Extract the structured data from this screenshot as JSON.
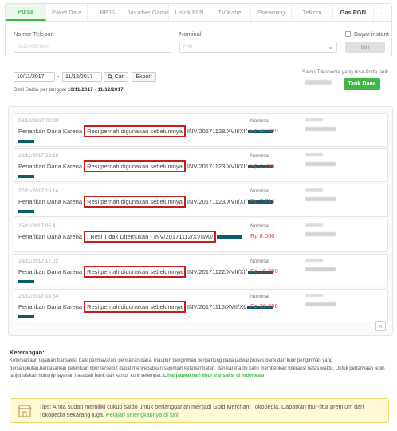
{
  "tabs": [
    {
      "label": "Pulsa",
      "active": true
    },
    {
      "label": "Paket Data"
    },
    {
      "label": "BPJS"
    },
    {
      "label": "Voucher Game"
    },
    {
      "label": "Listrik PLN"
    },
    {
      "label": "TV Kabel"
    },
    {
      "label": "Streaming"
    },
    {
      "label": "Telkom"
    },
    {
      "label": "Gas PGN"
    }
  ],
  "more_icon": "chevron-down-icon",
  "form": {
    "phone_label": "Nomor Telepon",
    "phone_placeholder": "081234567890",
    "nominal_label": "Nominal",
    "nominal_placeholder": "Pilih",
    "instant_label": "Bayar instant",
    "buy_label": "Beli"
  },
  "filter": {
    "start_date": "10/11/2017",
    "separator": "-",
    "end_date": "11/12/2017",
    "search_label": "Cari",
    "export_label": "Export",
    "detail_prefix": "Detil Saldo per tanggal",
    "detail_range": "10/11/2017 - 11/12/2017"
  },
  "saldo": {
    "label": "Saldo Tokopedia yang bisa Anda tarik",
    "withdraw_label": "Tarik Dana"
  },
  "transactions": [
    {
      "date": "08/12/2017 00:28",
      "prefix": "Penarikan Dana Karena",
      "reason": "Resi pernah digunakan sebelumnya",
      "invoice": "INV/20171128/XVII/XI/",
      "nominal_label": "Nominal",
      "amount": "Rp 40.000"
    },
    {
      "date": "28/11/2017 22:18",
      "prefix": "Penarikan Dana Karena",
      "reason": "Resi pernah digunakan sebelumnya",
      "invoice": "INV/20171123/XVII/XI/",
      "nominal_label": "Nominal",
      "amount": "Rp 2.286"
    },
    {
      "date": "27/11/2017 15:14",
      "prefix": "Penarikan Dana Karena",
      "reason": "Resi pernah digunakan sebelumnya",
      "invoice": "INV/20171123/XVII/XI/",
      "nominal_label": "Nominal",
      "amount": "Rp 7.714"
    },
    {
      "date": "25/11/2017 05:41",
      "prefix": "Penarikan Dana Karena",
      "reason": ": Resi Tidak Ditemukan - INV/20171112/XVII/XI/",
      "invoice": "",
      "nominal_label": "Nominal",
      "amount": "Rp 8.000"
    },
    {
      "date": "24/11/2017 17:02",
      "prefix": "Penarikan Dana Karena",
      "reason": "Resi pernah digunakan sebelumnya",
      "invoice": "INV/20171122/XVII/XI/",
      "nominal_label": "Nominal",
      "amount": "Rp 19.000"
    },
    {
      "date": "23/11/2017 09:54",
      "prefix": "Penarikan Dana Karena",
      "reason": "Resi pernah digunakan sebelumnya",
      "invoice": "INV/20171115/XVII/XI/",
      "nominal_label": "Nominal",
      "amount": "Rp 39.000"
    }
  ],
  "pager_label": "«",
  "keterangan": {
    "title": "Keterangan:",
    "body": "Ketersediaan layanan transaksi, baik pembayaran, pencairan dana, maupun pengiriman bergantung pada jadwal proses bank dan kurir pengiriman yang bersangkutan,berdasarkan ketentuan libur tersebut dapat menyebabkan sejumlah keterlambatan, dan karena itu kami memberikan toleransi batas waktu. Untuk pertanyaan lebih lanjut,silakan hubungi layanan nasabah bank dan kantor kurir setempat.",
    "link": "Lihat jadwal hari libur transaksi di Indonesia"
  },
  "tips": {
    "text": "Tips: Anda sudah memiliki cukup saldo untuk berlangganan menjadi Gold Merchant Tokopedia. Dapatkan fitur-fitur premium dari Tokopedia sekarang juga.",
    "link": "Pelajari selengkapnya di sini.",
    "icon": "store-icon"
  },
  "colors": {
    "accent": "#42b549",
    "amount": "#e0403a",
    "highlight": "#c81d1d",
    "redaction": "#0d5c6b"
  }
}
